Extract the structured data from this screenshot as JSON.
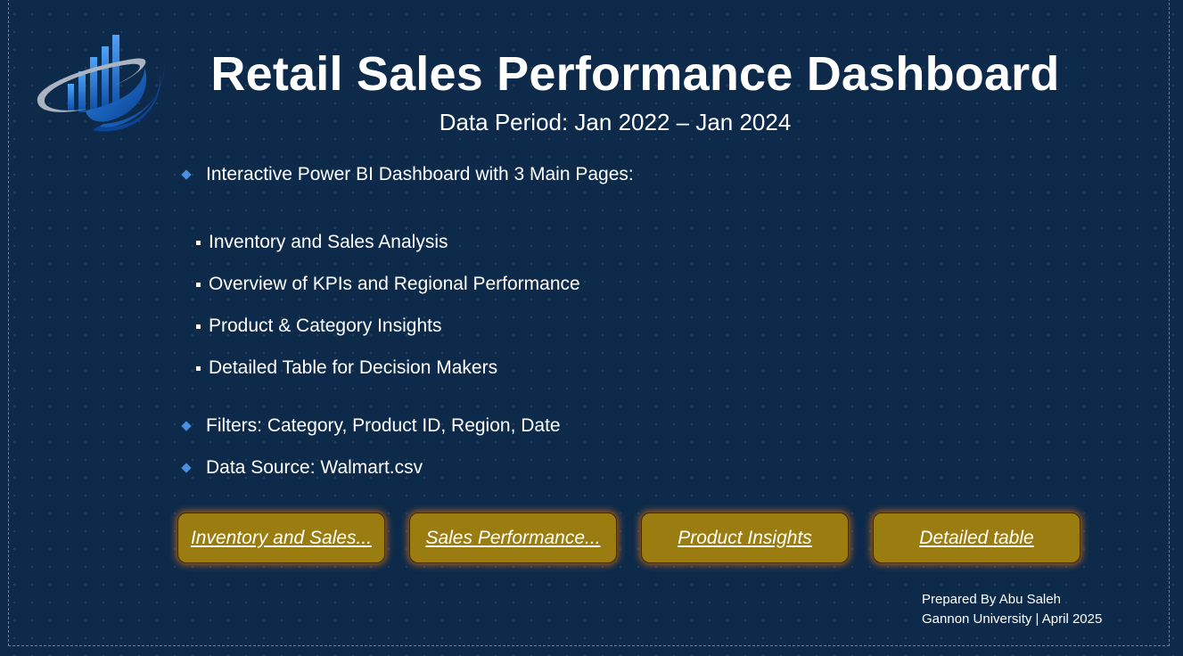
{
  "header": {
    "title": "Retail Sales Performance Dashboard",
    "subtitle": "Data Period: Jan 2022 – Jan 2024"
  },
  "logo": {
    "icon": "bar-chart-swoosh-logo",
    "colors": {
      "bars": "#1f6fd6",
      "ring": "#a9b3bf",
      "swoosh": "#1c5fb8"
    }
  },
  "content": {
    "intro": "Interactive Power BI Dashboard with 3 Main Pages:",
    "pages": [
      "Inventory and Sales Analysis",
      "Overview of KPIs and Regional Performance",
      "Product & Category Insights",
      "Detailed Table for Decision Makers"
    ],
    "filters": "Filters: Category, Product ID, Region, Date",
    "source": "Data Source: Walmart.csv"
  },
  "nav": {
    "buttons": [
      "Inventory and Sales...",
      "Sales Performance...",
      "Product Insights",
      "Detailed table"
    ]
  },
  "footer": {
    "line1": "Prepared By Abu Saleh",
    "line2": "Gannon University | April 2025"
  },
  "colors": {
    "background": "#0d2a4b",
    "button": "#9a7c10",
    "button_glow": "#d46e14",
    "bullet_accent": "#4a8fe0"
  }
}
